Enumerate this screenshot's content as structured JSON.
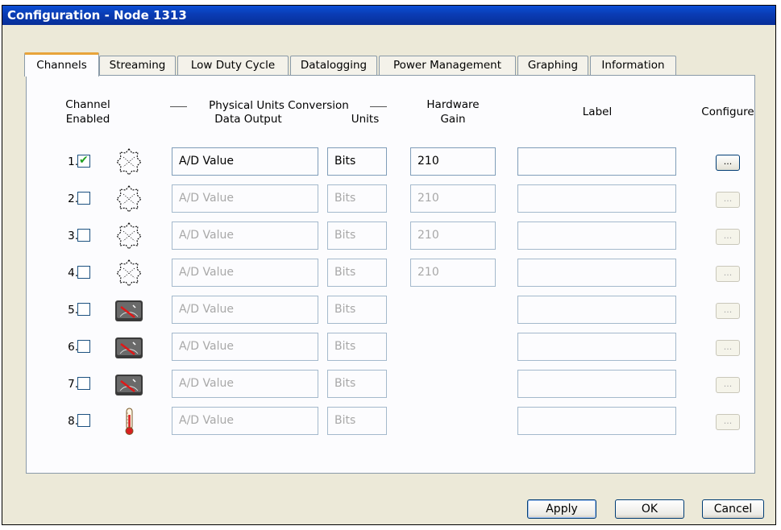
{
  "window": {
    "title": "Configuration - Node 1313"
  },
  "tabs": [
    {
      "label": "Channels",
      "active": true
    },
    {
      "label": "Streaming",
      "active": false
    },
    {
      "label": "Low Duty Cycle",
      "active": false
    },
    {
      "label": "Datalogging",
      "active": false
    },
    {
      "label": "Power Management",
      "active": false
    },
    {
      "label": "Graphing",
      "active": false
    },
    {
      "label": "Information",
      "active": false
    }
  ],
  "headers": {
    "channel_enabled_1": "Channel",
    "channel_enabled_2": "Enabled",
    "conversion_group": "Physical Units Conversion",
    "data_output": "Data Output",
    "units": "Units",
    "hardware_1": "Hardware",
    "hardware_2": "Gain",
    "label": "Label",
    "configure": "Configure"
  },
  "rows": [
    {
      "num": "1.",
      "enabled": true,
      "icon": "strain-gauge-icon",
      "data_output": "A/D Value",
      "units": "Bits",
      "gain": "210",
      "label": "",
      "configure": "..."
    },
    {
      "num": "2.",
      "enabled": false,
      "icon": "strain-gauge-icon",
      "data_output": "A/D Value",
      "units": "Bits",
      "gain": "210",
      "label": "",
      "configure": "..."
    },
    {
      "num": "3.",
      "enabled": false,
      "icon": "strain-gauge-icon",
      "data_output": "A/D Value",
      "units": "Bits",
      "gain": "210",
      "label": "",
      "configure": "..."
    },
    {
      "num": "4.",
      "enabled": false,
      "icon": "strain-gauge-icon",
      "data_output": "A/D Value",
      "units": "Bits",
      "gain": "210",
      "label": "",
      "configure": "..."
    },
    {
      "num": "5.",
      "enabled": false,
      "icon": "voltage-meter-icon",
      "data_output": "A/D Value",
      "units": "Bits",
      "gain": null,
      "label": "",
      "configure": "..."
    },
    {
      "num": "6.",
      "enabled": false,
      "icon": "voltage-meter-icon",
      "data_output": "A/D Value",
      "units": "Bits",
      "gain": null,
      "label": "",
      "configure": "..."
    },
    {
      "num": "7.",
      "enabled": false,
      "icon": "voltage-meter-icon",
      "data_output": "A/D Value",
      "units": "Bits",
      "gain": null,
      "label": "",
      "configure": "..."
    },
    {
      "num": "8.",
      "enabled": false,
      "icon": "thermometer-icon",
      "data_output": "A/D Value",
      "units": "Bits",
      "gain": null,
      "label": "",
      "configure": "..."
    }
  ],
  "buttons": {
    "apply": "Apply",
    "ok": "OK",
    "cancel": "Cancel"
  },
  "colors": {
    "titlebar": "#0a3cb3",
    "tab_accent": "#e8a43a",
    "check": "#21a121",
    "dialog_bg": "#ece9d8"
  }
}
